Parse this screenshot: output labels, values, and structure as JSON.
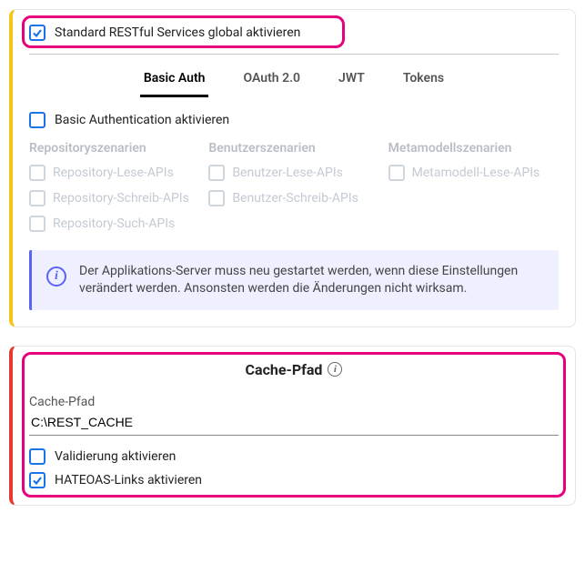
{
  "panels": {
    "rest": {
      "global_enable_label": "Standard RESTful Services global aktivieren",
      "global_enable_checked": true,
      "tabs": {
        "basic_auth": "Basic Auth",
        "oauth2": "OAuth 2.0",
        "jwt": "JWT",
        "tokens": "Tokens",
        "active": "basic_auth"
      },
      "basic_auth_enable_label": "Basic Authentication aktivieren",
      "basic_auth_enable_checked": false,
      "scenarios": {
        "repo": {
          "title": "Repositoryszenarien",
          "items": [
            "Repository-Lese-APIs",
            "Repository-Schreib-APIs",
            "Repository-Such-APIs"
          ]
        },
        "user": {
          "title": "Benutzerszenarien",
          "items": [
            "Benutzer-Lese-APIs",
            "Benutzer-Schreib-APIs"
          ]
        },
        "meta": {
          "title": "Metamodellszenarien",
          "items": [
            "Metamodell-Lese-APIs"
          ]
        }
      },
      "info_text": "Der Applikations-Server muss neu gestartet werden, wenn diese Einstellungen verändert werden. Ansonsten werden die Änderungen nicht wirksam."
    },
    "cache": {
      "title": "Cache-Pfad",
      "path_label": "Cache-Pfad",
      "path_value": "C:\\REST_CACHE",
      "validation_label": "Validierung aktivieren",
      "validation_checked": false,
      "hateoas_label": "HATEOAS-Links aktivieren",
      "hateoas_checked": true
    }
  }
}
